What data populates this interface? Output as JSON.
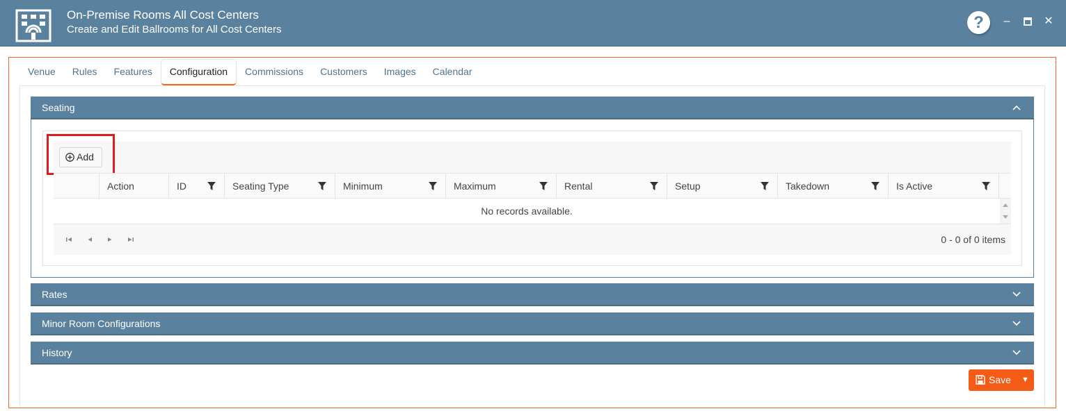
{
  "window": {
    "title": "On-Premise Rooms All Cost Centers",
    "subtitle": "Create and Edit Ballrooms for All Cost Centers",
    "help_label": "?",
    "minimize_label": "–",
    "maximize_label": "▭",
    "close_label": "✕"
  },
  "tabs": [
    {
      "label": "Venue"
    },
    {
      "label": "Rules"
    },
    {
      "label": "Features"
    },
    {
      "label": "Configuration",
      "active": true
    },
    {
      "label": "Commissions"
    },
    {
      "label": "Customers"
    },
    {
      "label": "Images"
    },
    {
      "label": "Calendar"
    }
  ],
  "panels": {
    "seating": {
      "title": "Seating",
      "expanded": true,
      "add_label": "Add",
      "columns": [
        "Action",
        "ID",
        "Seating Type",
        "Minimum",
        "Maximum",
        "Rental",
        "Setup",
        "Takedown",
        "Is Active"
      ],
      "empty_text": "No records available.",
      "pager_info": "0 - 0 of 0 items"
    },
    "rates": {
      "title": "Rates",
      "expanded": false
    },
    "minor": {
      "title": "Minor Room Configurations",
      "expanded": false
    },
    "history": {
      "title": "History",
      "expanded": false
    }
  },
  "actions": {
    "save_label": "Save",
    "save_caret": "▼"
  },
  "colors": {
    "header_bg": "#5a819e",
    "accent": "#f06a25",
    "save_bg": "#f35b16",
    "highlight": "#e01b1b"
  }
}
